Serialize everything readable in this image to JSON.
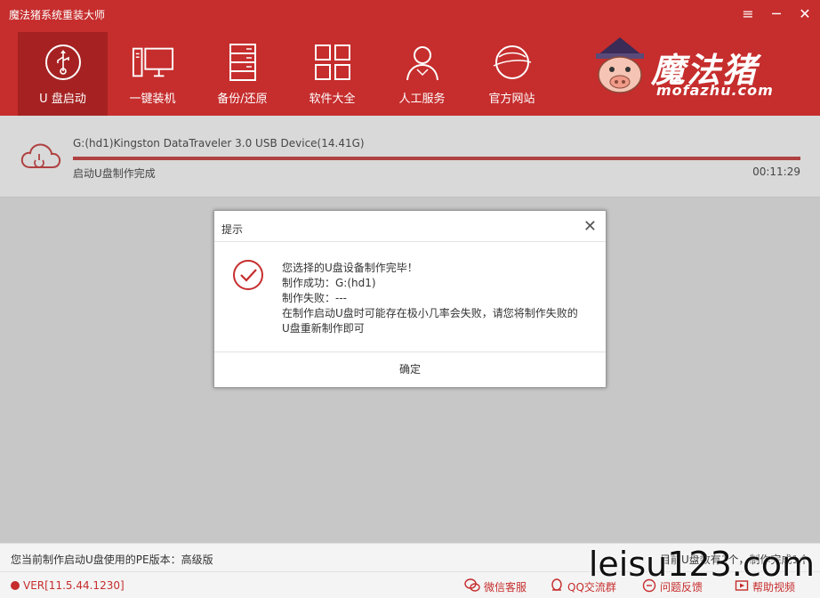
{
  "window": {
    "title": "魔法猪系统重装大师",
    "controls": {
      "menu": "≡",
      "minimize": "─",
      "close": "✕"
    }
  },
  "nav": {
    "items": [
      {
        "label": "U 盘启动",
        "icon": "usb-icon",
        "active": true
      },
      {
        "label": "一键装机",
        "icon": "computer-icon",
        "active": false
      },
      {
        "label": "备份/还原",
        "icon": "server-icon",
        "active": false
      },
      {
        "label": "软件大全",
        "icon": "grid-icon",
        "active": false
      },
      {
        "label": "人工服务",
        "icon": "person-icon",
        "active": false
      },
      {
        "label": "官方网站",
        "icon": "globe-icon",
        "active": false
      }
    ]
  },
  "logo": {
    "text": "魔法猪",
    "sub": "mofazhu.com"
  },
  "device": {
    "name": "G:(hd1)Kingston DataTraveler 3.0 USB Device(14.41G)",
    "status": "启动U盘制作完成",
    "timer": "00:11:29",
    "progress": 1.0
  },
  "dialog": {
    "title": "提示",
    "close": "✕",
    "lines": [
      "您选择的U盘设备制作完毕！",
      "制作成功：G:(hd1)",
      "制作失败：---",
      "在制作启动U盘时可能存在极小几率会失败，请您将制作失败的",
      "U盘重新制作即可"
    ],
    "ok_label": "确定"
  },
  "pe_bar": {
    "left": "您当前制作启动U盘使用的PE版本：高级版",
    "right": "目前U盘数有1个，制作完成1个"
  },
  "footer": {
    "version": "VER[11.5.44.1230]",
    "links": [
      {
        "label": "微信客服",
        "icon": "wechat-icon"
      },
      {
        "label": "QQ交流群",
        "icon": "qq-icon"
      },
      {
        "label": "问题反馈",
        "icon": "feedback-icon"
      },
      {
        "label": "帮助视频",
        "icon": "video-icon"
      }
    ]
  },
  "watermark": "leisu123.com",
  "colors": {
    "brand": "#c62d2d",
    "brand_dark": "#a62222"
  }
}
